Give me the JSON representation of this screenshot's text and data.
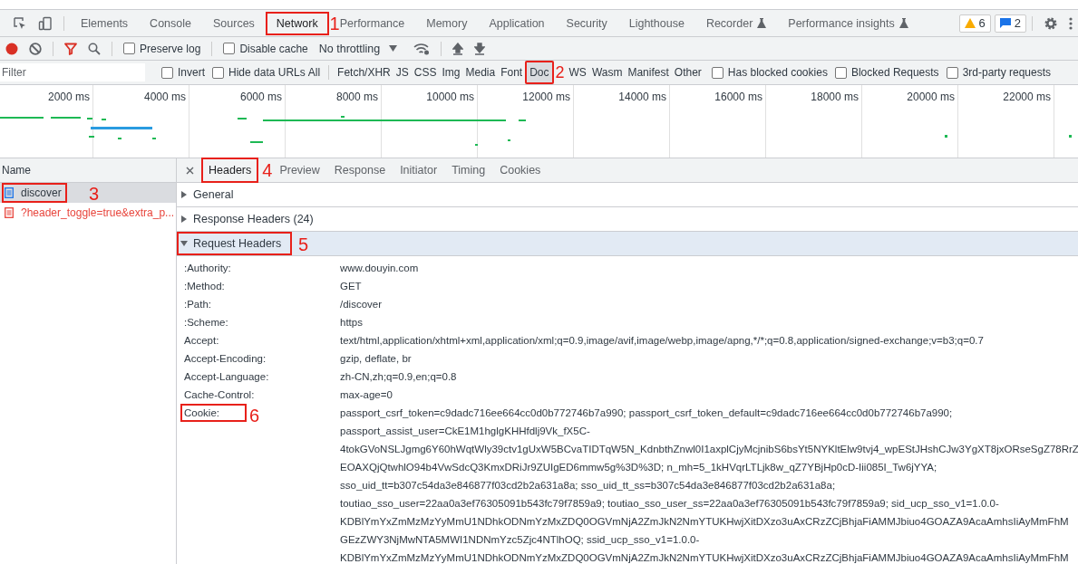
{
  "tabs": [
    {
      "label": "Elements",
      "selected": false
    },
    {
      "label": "Console",
      "selected": false
    },
    {
      "label": "Sources",
      "selected": false
    },
    {
      "label": "Network",
      "selected": true,
      "annotation": "1"
    },
    {
      "label": "Performance",
      "selected": false
    },
    {
      "label": "Memory",
      "selected": false
    },
    {
      "label": "Application",
      "selected": false
    },
    {
      "label": "Security",
      "selected": false
    },
    {
      "label": "Lighthouse",
      "selected": false
    },
    {
      "label": "Recorder",
      "selected": false,
      "experimental": true
    },
    {
      "label": "Performance insights",
      "selected": false,
      "experimental": true
    }
  ],
  "badges": {
    "warnings": "6",
    "messages": "2"
  },
  "toolbar": {
    "recording": true,
    "filter_active": true,
    "preserve_log": {
      "label": "Preserve log",
      "checked": false
    },
    "disable_cache": {
      "label": "Disable cache",
      "checked": false
    },
    "throttling": "No throttling"
  },
  "filter_bar": {
    "placeholder": "Filter",
    "checks": [
      {
        "label": "Invert",
        "checked": false
      },
      {
        "label": "Hide data URLs",
        "checked": false
      }
    ],
    "types": [
      {
        "label": "All",
        "selected": false
      },
      {
        "label": "Fetch/XHR",
        "selected": false
      },
      {
        "label": "JS",
        "selected": false
      },
      {
        "label": "CSS",
        "selected": false
      },
      {
        "label": "Img",
        "selected": false
      },
      {
        "label": "Media",
        "selected": false
      },
      {
        "label": "Font",
        "selected": false
      },
      {
        "label": "Doc",
        "selected": true,
        "annotation": "2"
      },
      {
        "label": "WS",
        "selected": false
      },
      {
        "label": "Wasm",
        "selected": false
      },
      {
        "label": "Manifest",
        "selected": false
      },
      {
        "label": "Other",
        "selected": false
      }
    ],
    "extra_checks": [
      {
        "label": "Has blocked cookies",
        "checked": false
      },
      {
        "label": "Blocked Requests",
        "checked": false
      },
      {
        "label": "3rd-party requests",
        "checked": false
      }
    ]
  },
  "timeline": {
    "ticks": [
      "2000 ms",
      "4000 ms",
      "6000 ms",
      "8000 ms",
      "10000 ms",
      "12000 ms",
      "14000 ms",
      "16000 ms",
      "18000 ms",
      "20000 ms",
      "22000 ms"
    ]
  },
  "requests_pane": {
    "column": "Name",
    "requests": [
      {
        "name": "discover",
        "selected": true,
        "failed": false,
        "annotation": "3"
      },
      {
        "name": "?header_toggle=true&extra_p...",
        "selected": false,
        "failed": true
      }
    ]
  },
  "detail_tabs": [
    {
      "label": "Headers",
      "selected": true,
      "annotation": "4"
    },
    {
      "label": "Preview",
      "selected": false
    },
    {
      "label": "Response",
      "selected": false
    },
    {
      "label": "Initiator",
      "selected": false
    },
    {
      "label": "Timing",
      "selected": false
    },
    {
      "label": "Cookies",
      "selected": false
    }
  ],
  "sections": [
    {
      "title": "General",
      "expanded": false
    },
    {
      "title": "Response Headers (24)",
      "expanded": false
    },
    {
      "title": "Request Headers",
      "expanded": true,
      "annotation": "5"
    }
  ],
  "request_headers": [
    {
      "name": ":Authority:",
      "value": [
        "www.douyin.com"
      ]
    },
    {
      "name": ":Method:",
      "value": [
        "GET"
      ]
    },
    {
      "name": ":Path:",
      "value": [
        "/discover"
      ]
    },
    {
      "name": ":Scheme:",
      "value": [
        "https"
      ]
    },
    {
      "name": "Accept:",
      "value": [
        "text/html,application/xhtml+xml,application/xml;q=0.9,image/avif,image/webp,image/apng,*/*;q=0.8,application/signed-exchange;v=b3;q=0.7"
      ]
    },
    {
      "name": "Accept-Encoding:",
      "value": [
        "gzip, deflate, br"
      ]
    },
    {
      "name": "Accept-Language:",
      "value": [
        "zh-CN,zh;q=0.9,en;q=0.8"
      ]
    },
    {
      "name": "Cache-Control:",
      "value": [
        "max-age=0"
      ]
    },
    {
      "name": "Cookie:",
      "annotation": "6",
      "value": [
        "passport_csrf_token=c9dadc716ee664cc0d0b772746b7a990; passport_csrf_token_default=c9dadc716ee664cc0d0b772746b7a990;",
        "passport_assist_user=CkE1M1hglgKHHfdlj9Vk_fX5C-",
        "4tokGVoNSLJgmg6Y60hWqtWly39ctv1gUxW5BCvaTIDTqW5N_KdnbthZnwl0I1axplCjyMcjnibS6bsYt5NYKltElw9tvj4_wpEStJHshCJw3YgXT8jxORseSgZ78RrZ",
        "EOAXQjQtwhlO94b4VwSdcQ3KmxDRiJr9ZUIgED6mmw5g%3D%3D; n_mh=5_1kHVqrLTLjk8w_qZ7YBjHp0cD-Iii085I_Tw6jYYA;",
        "sso_uid_tt=b307c54da3e846877f03cd2b2a631a8a; sso_uid_tt_ss=b307c54da3e846877f03cd2b2a631a8a;",
        "toutiao_sso_user=22aa0a3ef76305091b543fc79f7859a9; toutiao_sso_user_ss=22aa0a3ef76305091b543fc79f7859a9; sid_ucp_sso_v1=1.0.0-",
        "KDBlYmYxZmMzMzYyMmU1NDhkODNmYzMxZDQ0OGVmNjA2ZmJkN2NmYTUKHwjXitDXzo3uAxCRzZCjBhjaFiAMMJbiuo4GOAZA9AcaAmhsIiAyMmFhM",
        "GEzZWY3NjMwNTA5MWI1NDNmYzc5Zjc4NTlhOQ; ssid_ucp_sso_v1=1.0.0-",
        "KDBlYmYxZmMzMzYyMmU1NDhkODNmYzMxZDQ0OGVmNjA2ZmJkN2NmYTUKHwjXitDXzo3uAxCRzZCjBhjaFiAMMJbiuo4GOAZA9AcaAmhsIiAyMmFhM"
      ]
    }
  ]
}
